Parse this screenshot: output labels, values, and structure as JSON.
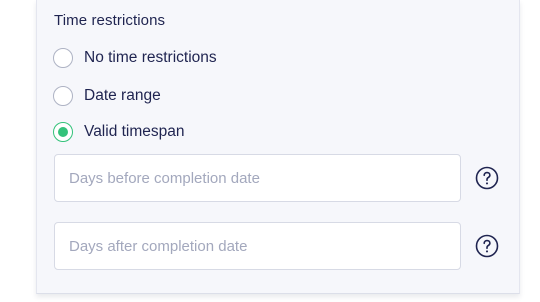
{
  "section": {
    "title": "Time restrictions"
  },
  "options": [
    {
      "label": "No time restrictions",
      "selected": false
    },
    {
      "label": "Date range",
      "selected": false
    },
    {
      "label": "Valid timespan",
      "selected": true
    }
  ],
  "fields": {
    "days_before": {
      "value": "",
      "placeholder": "Days before completion date",
      "help_icon": "question-circle-icon"
    },
    "days_after": {
      "value": "",
      "placeholder": "Days after completion date",
      "help_icon": "question-circle-icon"
    }
  },
  "colors": {
    "accent": "#33c27a",
    "text": "#1f2450",
    "placeholder": "#a3a8bd",
    "panel_background": "#f6f7fb"
  }
}
